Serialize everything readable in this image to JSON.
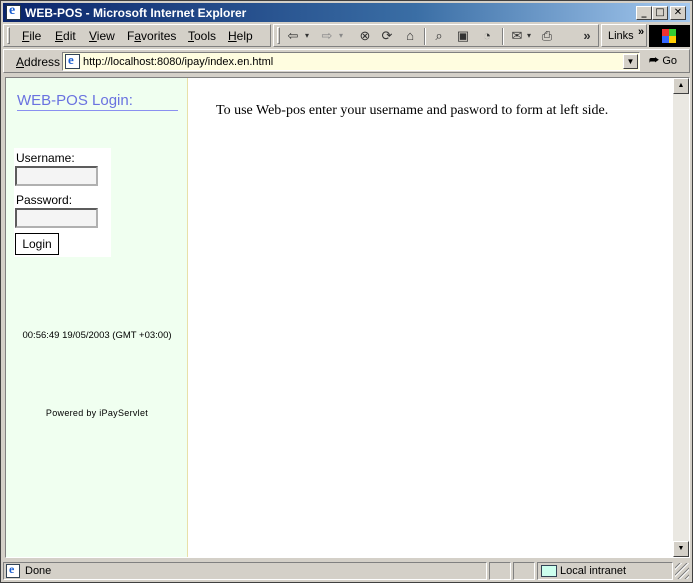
{
  "window": {
    "title": "WEB-POS - Microsoft Internet Explorer",
    "controls": {
      "minimize": "_",
      "maximize": "□",
      "close": "✕"
    }
  },
  "menu": {
    "items": [
      {
        "label": "File",
        "accel": "F"
      },
      {
        "label": "Edit",
        "accel": "E"
      },
      {
        "label": "View",
        "accel": "V"
      },
      {
        "label": "Favorites",
        "accel": "a"
      },
      {
        "label": "Tools",
        "accel": "T"
      },
      {
        "label": "Help",
        "accel": "H"
      }
    ]
  },
  "toolbar": {
    "icons": [
      "back-arrow-icon",
      "forward-arrow-icon",
      "stop-icon",
      "refresh-icon",
      "home-icon",
      "search-icon",
      "favorites-icon",
      "history-icon",
      "mail-icon",
      "print-icon"
    ],
    "links_label": "Links",
    "chevron": "»"
  },
  "address": {
    "label": "Address",
    "url": "http://localhost:8080/ipay/index.en.html",
    "go_label": "Go"
  },
  "left_frame": {
    "title": "WEB-POS Login:",
    "username_label": "Username:",
    "username_value": "",
    "password_label": "Password:",
    "password_value": "",
    "login_button": "Login",
    "timestamp": "00:56:49 19/05/2003 (GMT +03:00)",
    "powered_by": "Powered by iPayServlet"
  },
  "main_frame": {
    "message": "To use Web-pos enter your username and pasword to form at left side."
  },
  "status": {
    "text": "Done",
    "zone": "Local intranet"
  },
  "colors": {
    "title_bar": "#0a246a",
    "left_frame_bg": "#f0fff0",
    "login_title": "#6a72e0",
    "address_bg": "#fffde0"
  }
}
